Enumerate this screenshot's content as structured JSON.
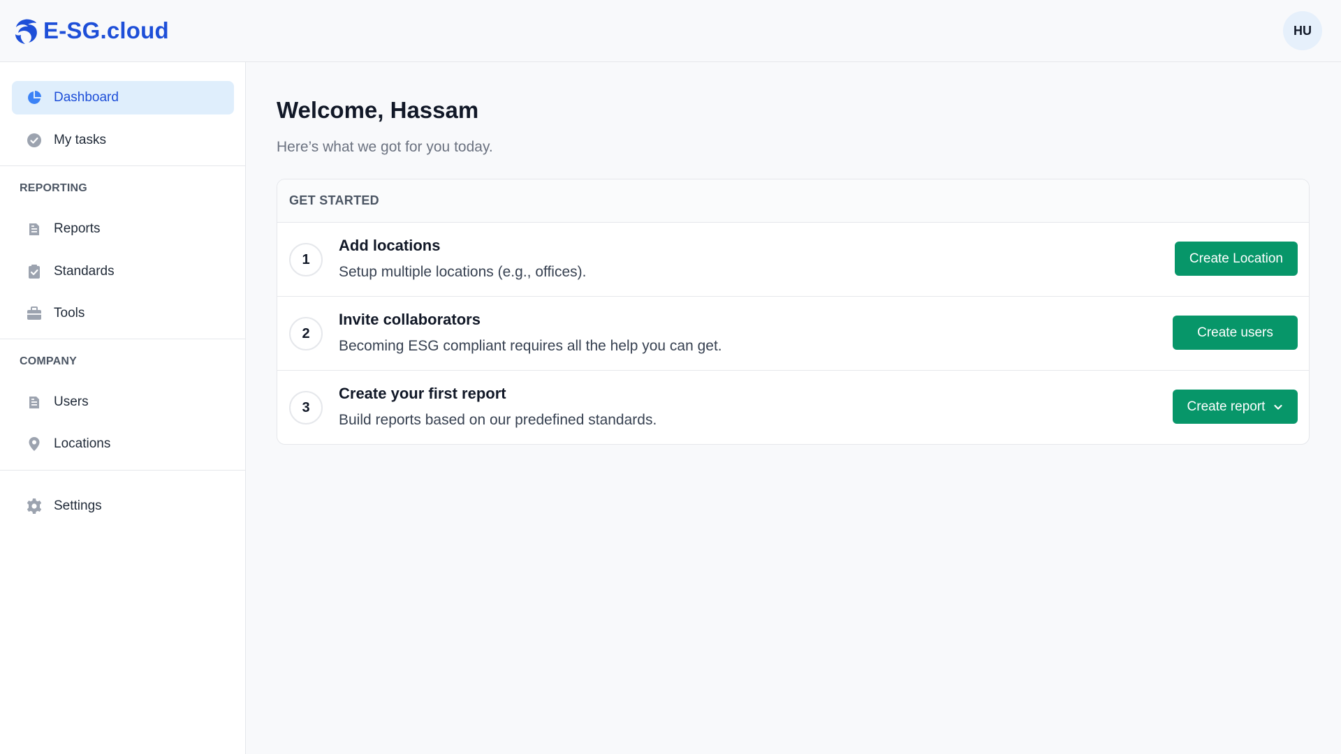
{
  "header": {
    "logo_text": "E-SG.cloud",
    "avatar_initials": "HU"
  },
  "sidebar": {
    "top_items": [
      {
        "label": "Dashboard",
        "icon": "pie-chart-icon",
        "active": true
      },
      {
        "label": "My tasks",
        "icon": "check-circle-icon",
        "active": false
      }
    ],
    "sections": [
      {
        "title": "REPORTING",
        "items": [
          {
            "label": "Reports",
            "icon": "document-icon"
          },
          {
            "label": "Standards",
            "icon": "clipboard-check-icon"
          },
          {
            "label": "Tools",
            "icon": "briefcase-icon"
          }
        ]
      },
      {
        "title": "COMPANY",
        "items": [
          {
            "label": "Users",
            "icon": "document-icon"
          },
          {
            "label": "Locations",
            "icon": "map-pin-icon"
          }
        ]
      }
    ],
    "settings_label": "Settings"
  },
  "main": {
    "welcome": "Welcome, Hassam",
    "subtitle": "Here’s what we got for you today.",
    "card": {
      "header": "GET STARTED",
      "steps": [
        {
          "number": "1",
          "title": "Add locations",
          "description": "Setup multiple locations (e.g., offices).",
          "button": "Create Location"
        },
        {
          "number": "2",
          "title": "Invite collaborators",
          "description": "Becoming ESG compliant requires all the help you can get.",
          "button": "Create users"
        },
        {
          "number": "3",
          "title": "Create your first report",
          "description": "Build reports based on our predefined standards.",
          "button": "Create report"
        }
      ]
    }
  },
  "colors": {
    "brand": "#1e4fd8",
    "primary_button": "#079669",
    "active_nav_bg": "#dfeefc"
  }
}
